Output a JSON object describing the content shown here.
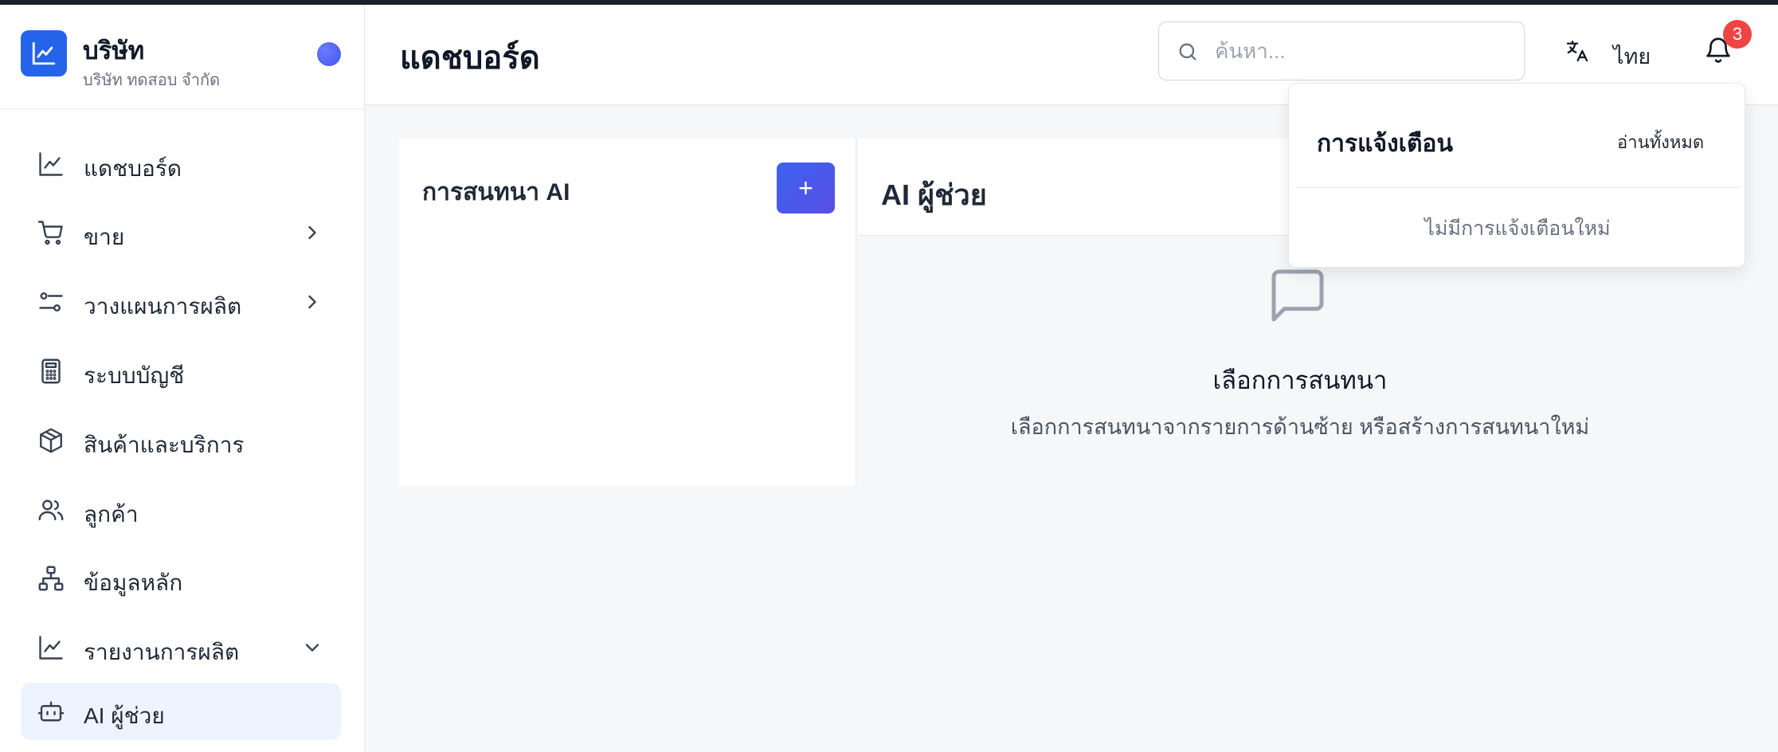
{
  "brand": {
    "name": "บริษัท",
    "subtitle": "บริษัท ทดสอบ จำกัด",
    "accent_color": "#2563eb"
  },
  "sidebar": {
    "items": [
      {
        "label": "แดชบอร์ด",
        "icon": "chart-line-icon",
        "chevron": null,
        "active": false
      },
      {
        "label": "ขาย",
        "icon": "cart-icon",
        "chevron": "chevron-right-icon",
        "active": false
      },
      {
        "label": "วางแผนการผลิต",
        "icon": "sliders-icon",
        "chevron": "chevron-right-icon",
        "active": false
      },
      {
        "label": "ระบบบัญชี",
        "icon": "calculator-icon",
        "chevron": null,
        "active": false
      },
      {
        "label": "สินค้าและบริการ",
        "icon": "package-icon",
        "chevron": null,
        "active": false
      },
      {
        "label": "ลูกค้า",
        "icon": "users-icon",
        "chevron": null,
        "active": false
      },
      {
        "label": "ข้อมูลหลัก",
        "icon": "network-icon",
        "chevron": null,
        "active": false
      },
      {
        "label": "รายงานการผลิต",
        "icon": "chart-line-icon",
        "chevron": "chevron-down-icon",
        "active": false
      },
      {
        "label": "AI ผู้ช่วย",
        "icon": "bot-icon",
        "chevron": null,
        "active": true
      }
    ]
  },
  "header": {
    "title": "แดชบอร์ด",
    "search_placeholder": "ค้นหา...",
    "language_label": "ไทย",
    "notification_count": "3"
  },
  "conversations": {
    "title": "การสนทนา AI",
    "new_button_label": "+"
  },
  "chat": {
    "title": "AI ผู้ช่วย",
    "empty_title": "เลือกการสนทนา",
    "empty_description": "เลือกการสนทนาจากรายการด้านซ้าย หรือสร้างการสนทนาใหม่"
  },
  "notifications": {
    "title": "การแจ้งเตือน",
    "read_all_label": "อ่านทั้งหมด",
    "empty_label": "ไม่มีการแจ้งเตือนใหม่"
  }
}
